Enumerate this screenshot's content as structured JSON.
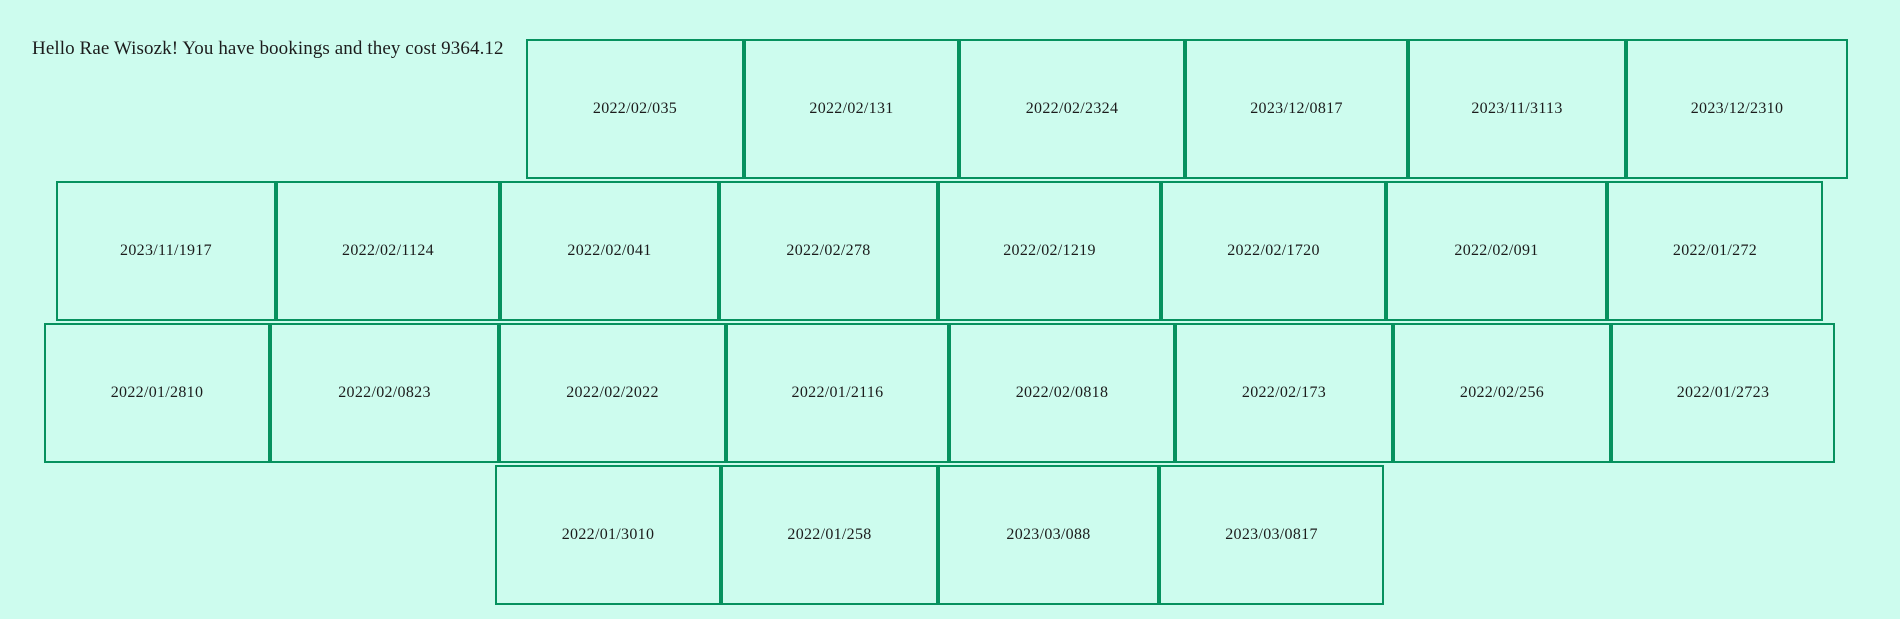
{
  "greeting": "Hello Rae Wisozk! You have bookings and they cost 9364.12",
  "rows": [
    [
      "2022/02/035",
      "2022/02/131",
      "2022/02/2324",
      "2023/12/0817",
      "2023/11/3113",
      "2023/12/2310"
    ],
    [
      "2023/11/1917",
      "2022/02/1124",
      "2022/02/041",
      "2022/02/278",
      "2022/02/1219",
      "2022/02/1720",
      "2022/02/091",
      "2022/01/272"
    ],
    [
      "2022/01/2810",
      "2022/02/0823",
      "2022/02/2022",
      "2022/01/2116",
      "2022/02/0818",
      "2022/02/173",
      "2022/02/256",
      "2022/01/2723"
    ],
    [
      "2022/01/3010",
      "2022/01/258",
      "2023/03/088",
      "2023/03/0817"
    ]
  ],
  "colors": {
    "background": "#cdfcee",
    "border": "#06915e"
  }
}
